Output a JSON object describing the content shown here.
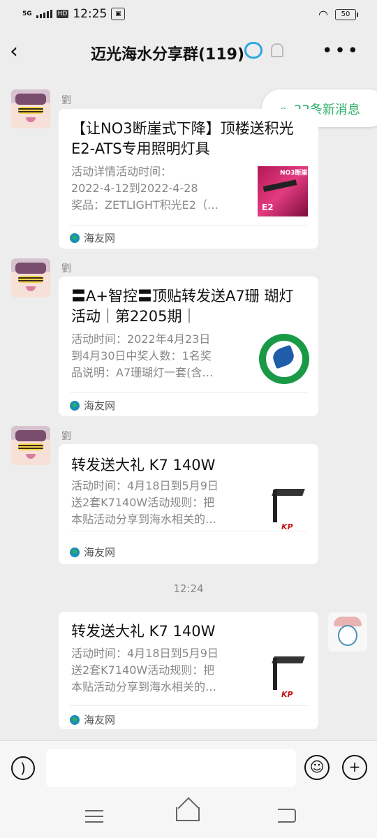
{
  "status_bar": {
    "network": "5G",
    "hd": "HD",
    "time": "12:25",
    "battery": "50"
  },
  "header": {
    "back_icon": "back-arrow-icon",
    "title": "迈光海水分享群(119)",
    "more_icon": "more-dots-icon"
  },
  "new_messages": {
    "label": "22条新消息"
  },
  "messages": [
    {
      "sender": "劉",
      "title": "【让NO3断崖式下降】顶楼送积光E2-ATS专用照明灯具",
      "desc": "活动详情活动时间：\n2022-4-12到2022-4-28\n奖品：ZETLIGHT积光E2（…",
      "thumb_text_1": "NO3断崖",
      "thumb_text_2": "E2",
      "source": "海友网"
    },
    {
      "sender": "劉",
      "title": "〓A+智控〓顶贴转发送A7珊 瑚灯活动｜第2205期｜",
      "desc": "活动时间：2022年4月23日\n到4月30日中奖人数：1名奖\n品说明：A7珊瑚灯一套(含…",
      "source": "海友网"
    },
    {
      "sender": "劉",
      "title": "转发送大礼 K7 140W",
      "desc": "活动时间：4月18日到5月9日\n送2套K7140W活动规则：把\n本贴活动分享到海水相关的…",
      "thumb_text": "KP",
      "source": "海友网"
    },
    {
      "title": "转发送大礼 K7 140W",
      "desc": "活动时间：4月18日到5月9日\n送2套K7140W活动规则：把\n本贴活动分享到海水相关的…",
      "thumb_text": "KP",
      "source": "海友网"
    }
  ],
  "timestamp": "12:24",
  "input_bar": {
    "voice_icon": "voice-icon",
    "emoji_icon": "emoji-icon",
    "plus_icon": "plus-icon",
    "text": ""
  }
}
